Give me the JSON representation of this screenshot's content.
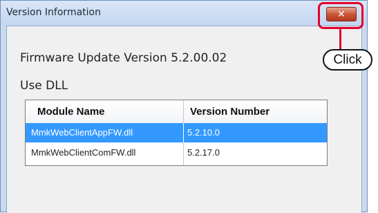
{
  "window": {
    "title": "Version Information",
    "close_glyph": "✕"
  },
  "content": {
    "firmware_label": "Firmware Update Version 5.2.00.02",
    "dll_label": "Use DLL"
  },
  "table": {
    "columns": [
      "Module Name",
      "Version Number"
    ],
    "rows": [
      {
        "module": "MmkWebClientAppFW.dll",
        "version": "5.2.10.0",
        "selected": true
      },
      {
        "module": "MmkWebClientComFW.dll",
        "version": "5.2.17.0",
        "selected": false
      }
    ]
  },
  "annotation": {
    "label": "Click"
  },
  "colors": {
    "selection": "#3399ff",
    "callout": "#e3002b"
  }
}
